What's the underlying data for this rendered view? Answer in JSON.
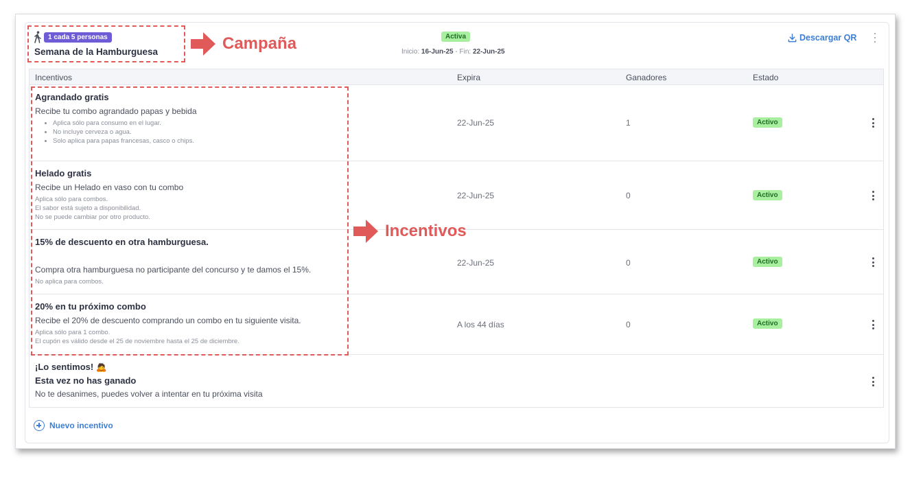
{
  "campaign": {
    "badge": "1 cada 5 personas",
    "title": "Semana de la Hamburguesa",
    "status": "Activa",
    "start_label": "Inicio:",
    "start": "16-Jun-25",
    "sep": "- Fin:",
    "end": "22-Jun-25",
    "download": "Descargar QR"
  },
  "annotations": {
    "campaign": "Campaña",
    "incentives": "Incentivos"
  },
  "table": {
    "headers": [
      "Incentivos",
      "Expira",
      "Ganadores",
      "Estado"
    ],
    "rows": [
      {
        "title": "Agrandado gratis",
        "desc": "Recibe tu combo agrandado papas y bebida",
        "notes": [
          "Aplica sólo para consumo en el lugar.",
          "No incluye cerveza o agua.",
          "Solo aplica para papas francesas, casco o chips."
        ],
        "expira": "22-Jun-25",
        "ganadores": "1",
        "estado": "Activo"
      },
      {
        "title": "Helado gratis",
        "desc": "Recibe un Helado en vaso con tu combo",
        "notes": [
          "Aplica sólo para combos.",
          "El sabor está sujeto a disponibilidad.",
          "No se puede cambiar por otro producto."
        ],
        "expira": "22-Jun-25",
        "ganadores": "0",
        "estado": "Activo"
      },
      {
        "title": "15% de descuento en otra hamburguesa.",
        "desc": "Compra otra hamburguesa no participante del concurso y te damos el 15%.",
        "notes": [
          "No aplica para combos."
        ],
        "expira": "22-Jun-25",
        "ganadores": "0",
        "estado": "Activo"
      },
      {
        "title": "20% en tu próximo combo",
        "desc": "Recibe el 20% de descuento comprando un combo en tu siguiente visita.",
        "notes": [
          "Aplica sólo para 1 combo.",
          "El cupón es válido desde el 25 de noviembre hasta el 25 de diciembre."
        ],
        "expira": "A los 44 días",
        "ganadores": "0",
        "estado": "Activo"
      }
    ],
    "loser": {
      "title": "¡Lo sentimos! 🙇",
      "subtitle": "Esta vez no has ganado",
      "desc": "No te desanimes, puedes volver a intentar en tu próxima visita"
    }
  },
  "new_incentive": "Nuevo incentivo",
  "colors": {
    "accent": "#3b7fd6",
    "badge": "#6e5bd6",
    "status_bg": "#a8f0a0",
    "annotation": "#e05a5a"
  }
}
